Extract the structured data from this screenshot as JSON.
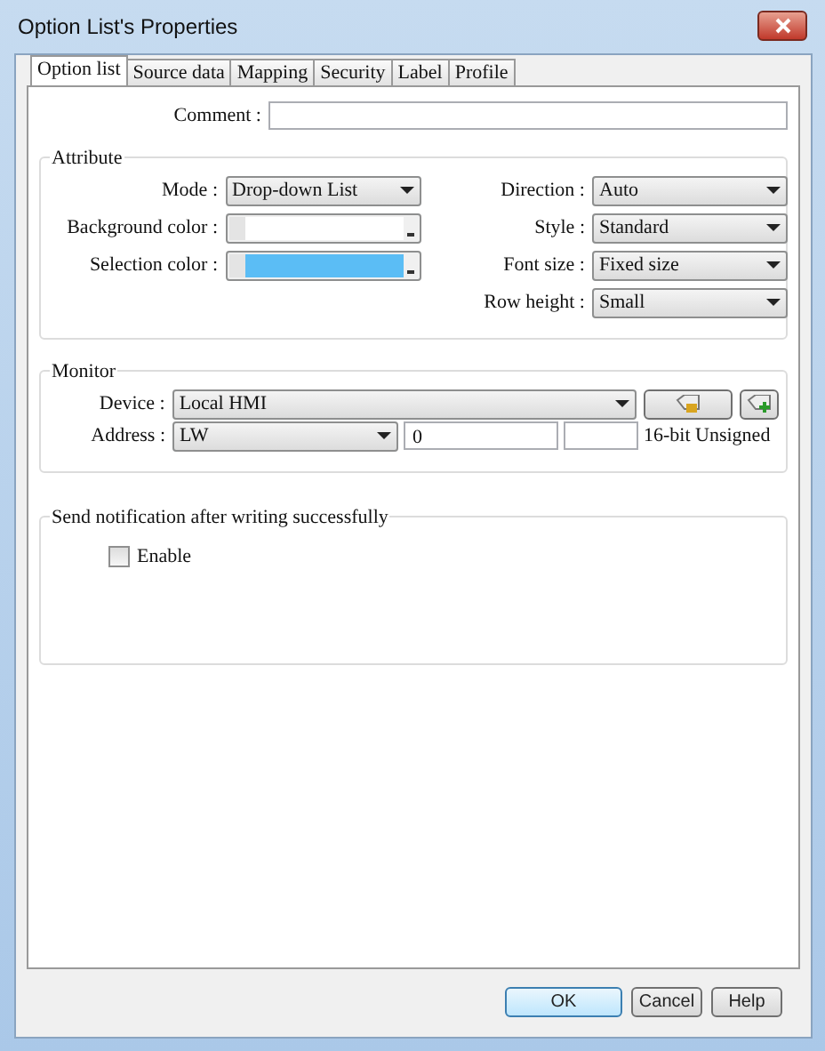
{
  "window": {
    "title": "Option List's Properties"
  },
  "tabs": [
    {
      "label": "Option list",
      "selected": true
    },
    {
      "label": "Source data",
      "selected": false
    },
    {
      "label": "Mapping",
      "selected": false
    },
    {
      "label": "Security",
      "selected": false
    },
    {
      "label": "Label",
      "selected": false
    },
    {
      "label": "Profile",
      "selected": false
    }
  ],
  "comment": {
    "label": "Comment :"
  },
  "attribute": {
    "title": "Attribute",
    "left": [
      {
        "kind": "dropdown",
        "label": "Mode :",
        "value": "Drop-down List"
      },
      {
        "kind": "color",
        "label": "Background color :",
        "color": "#ffffff"
      },
      {
        "kind": "color",
        "label": "Selection color :",
        "color": "#5bbdf5"
      }
    ],
    "right": [
      {
        "kind": "dropdown",
        "label": "Direction :",
        "value": "Auto"
      },
      {
        "kind": "dropdown",
        "label": "Style :",
        "value": "Standard"
      },
      {
        "kind": "dropdown",
        "label": "Font size :",
        "value": "Fixed size"
      },
      {
        "kind": "dropdown",
        "label": "Row height :",
        "value": "Small"
      }
    ]
  },
  "monitor": {
    "title": "Monitor",
    "device": {
      "label": "Device :",
      "value": "Local HMI"
    },
    "address": {
      "label": "Address :",
      "type": "LW",
      "value": "0",
      "format": "16-bit Unsigned"
    }
  },
  "notification": {
    "title": "Send notification after writing successfully",
    "enable": {
      "label": "Enable",
      "checked": false
    }
  },
  "buttons": [
    {
      "label": "OK",
      "default": true
    },
    {
      "label": "Cancel",
      "default": false
    },
    {
      "label": "Help",
      "default": false
    }
  ]
}
